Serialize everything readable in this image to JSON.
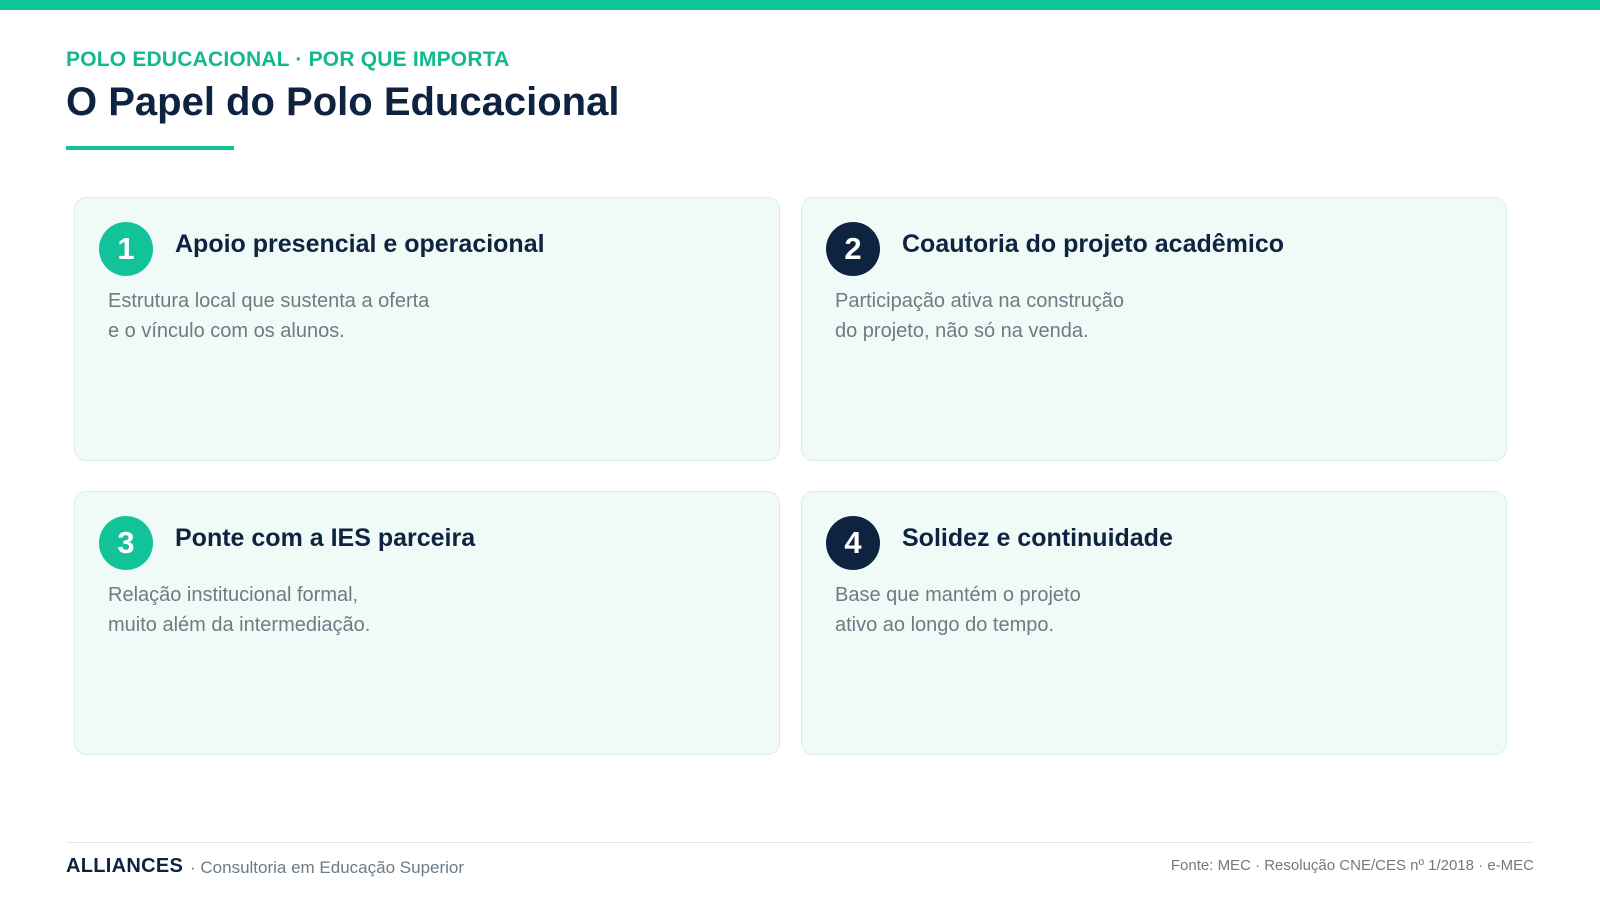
{
  "header": {
    "eyebrow": "POLO EDUCACIONAL · POR QUE IMPORTA",
    "title": "O Papel do Polo Educacional"
  },
  "cards": [
    {
      "number": "1",
      "title": "Apoio presencial e operacional",
      "desc_lines": [
        "Estrutura local que sustenta a oferta",
        "e o vínculo com os alunos."
      ],
      "badge_color": "#12c298"
    },
    {
      "number": "2",
      "title": "Coautoria do projeto acadêmico",
      "desc_lines": [
        "Participação ativa na construção",
        "do projeto, não só na venda."
      ],
      "badge_color": "#0e2340"
    },
    {
      "number": "3",
      "title": "Ponte com a IES parceira",
      "desc_lines": [
        "Relação institucional formal,",
        "muito além da intermediação."
      ],
      "badge_color": "#12c298"
    },
    {
      "number": "4",
      "title": "Solidez e continuidade",
      "desc_lines": [
        "Base que mantém o projeto",
        "ativo ao longo do tempo."
      ],
      "badge_color": "#0e2340"
    }
  ],
  "footer": {
    "brand": "ALLIANCES",
    "tagline": "· Consultoria em Educação Superior",
    "source": "Fonte: MEC · Resolução CNE/CES nº 1/2018 · e-MEC"
  },
  "colors": {
    "accent": "#0fc497",
    "navy": "#0e2340",
    "card_bg": "#f0faf6",
    "muted_text": "#6d7b86"
  }
}
